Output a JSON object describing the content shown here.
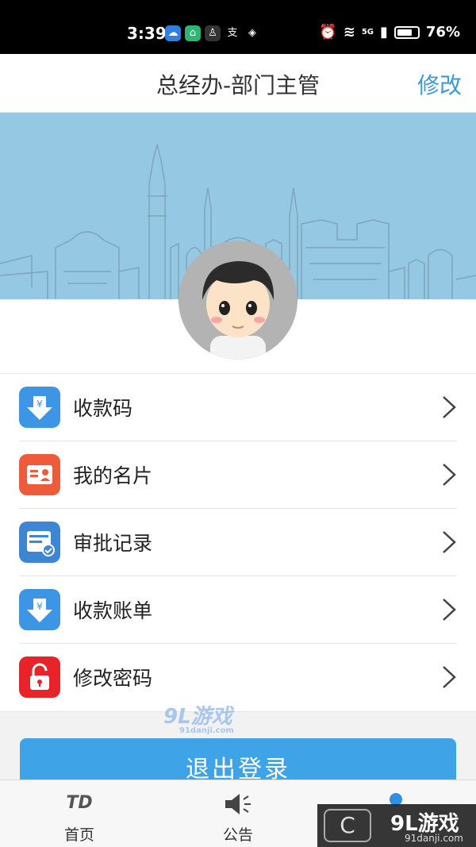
{
  "status_bar": {
    "time": "3:39",
    "battery": "76%",
    "network": "5G"
  },
  "nav": {
    "title": "总经办-部门主管",
    "edit_label": "修改"
  },
  "menu": {
    "items": [
      {
        "label": "收款码",
        "icon": "yen-download-icon",
        "color": "#3d95e6"
      },
      {
        "label": "我的名片",
        "icon": "business-card-icon",
        "color": "#ef5a3a"
      },
      {
        "label": "审批记录",
        "icon": "approval-record-icon",
        "color": "#3d86d6"
      },
      {
        "label": "收款账单",
        "icon": "yen-download-icon",
        "color": "#3d95e6"
      },
      {
        "label": "修改密码",
        "icon": "lock-icon",
        "color": "#e8242a"
      }
    ]
  },
  "logout_label": "退出登录",
  "tabs": [
    {
      "label": "首页",
      "icon_text": "TD"
    },
    {
      "label": "公告"
    }
  ],
  "watermark": {
    "main": "9L游戏",
    "sub": "91danji.com"
  }
}
